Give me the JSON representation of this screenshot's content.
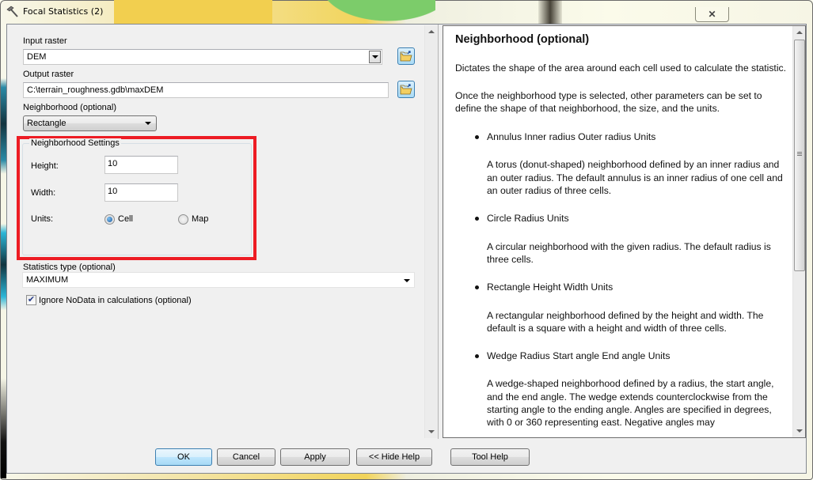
{
  "window": {
    "title": "Focal Statistics (2)",
    "close_label": "✕"
  },
  "params": {
    "input_raster": {
      "label": "Input raster",
      "value": "DEM"
    },
    "output_raster": {
      "label": "Output raster",
      "value": "C:\\terrain_roughness.gdb\\maxDEM"
    },
    "neighborhood": {
      "label": "Neighborhood (optional)",
      "value": "Rectangle"
    },
    "neighborhood_settings": {
      "title": "Neighborhood Settings",
      "height_label": "Height:",
      "height_value": "10",
      "width_label": "Width:",
      "width_value": "10",
      "units_label": "Units:",
      "units_options": [
        {
          "label": "Cell",
          "checked": true
        },
        {
          "label": "Map",
          "checked": false
        }
      ]
    },
    "statistics_type": {
      "label": "Statistics type (optional)",
      "value": "MAXIMUM"
    },
    "ignore_nodata": {
      "label": "Ignore NoData in calculations (optional)",
      "checked": true
    }
  },
  "help": {
    "title": "Neighborhood (optional)",
    "paragraphs": [
      "Dictates the shape of the area around each cell used to calculate the statistic.",
      "Once the neighborhood type is selected, other parameters can be set to define the shape of that neighborhood, the size, and the units."
    ],
    "items": [
      {
        "title": "Annulus Inner radius Outer radius Units",
        "desc": "A torus (donut-shaped) neighborhood defined by an inner radius and an outer radius. The default annulus is an inner radius of one cell and an outer radius of three cells."
      },
      {
        "title": "Circle Radius Units",
        "desc": "A circular neighborhood with the given radius. The default radius is three cells."
      },
      {
        "title": "Rectangle Height Width Units",
        "desc": "A rectangular neighborhood defined by the height and width. The default is a square with a height and width of three cells."
      },
      {
        "title": "Wedge Radius Start angle End angle Units",
        "desc": "A wedge-shaped neighborhood defined by a radius, the start angle, and the end angle. The wedge extends counterclockwise from the starting angle to the ending angle. Angles are specified in degrees, with 0 or 360 representing east. Negative angles may"
      }
    ]
  },
  "buttons": {
    "ok": "OK",
    "cancel": "Cancel",
    "apply": "Apply",
    "hide_help": "<< Hide Help",
    "tool_help": "Tool Help"
  },
  "colors": {
    "highlight": "#ed1c24",
    "default_button": "#3c7fb1"
  }
}
